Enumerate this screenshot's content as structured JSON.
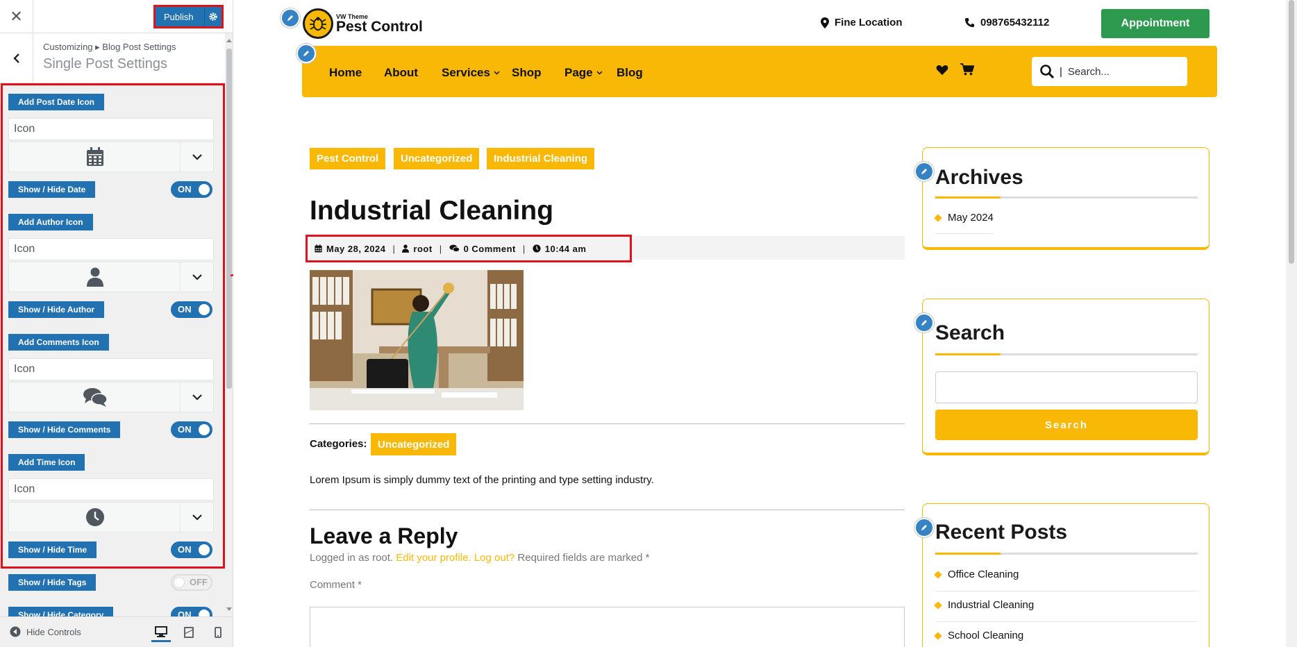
{
  "customizer": {
    "publish_label": "Publish",
    "breadcrumb": "Customizing ▸ Blog Post Settings",
    "section_title": "Single Post Settings",
    "controls": [
      {
        "button": "Add Post Date Icon",
        "field": "Icon",
        "icon": "calendar-icon",
        "toggle_label": "Show / Hide Date",
        "toggle": "ON"
      },
      {
        "button": "Add Author Icon",
        "field": "Icon",
        "icon": "user-icon",
        "toggle_label": "Show / Hide Author",
        "toggle": "ON"
      },
      {
        "button": "Add Comments Icon",
        "field": "Icon",
        "icon": "comments-icon",
        "toggle_label": "Show / Hide Comments",
        "toggle": "ON"
      },
      {
        "button": "Add Time Icon",
        "field": "Icon",
        "icon": "clock-icon",
        "toggle_label": "Show / Hide Time",
        "toggle": "ON"
      }
    ],
    "tags_toggle_label": "Show / Hide Tags",
    "tags_toggle": "OFF",
    "category_toggle_label": "Show / Hide Category",
    "category_toggle": "ON",
    "hide_controls": "Hide Controls"
  },
  "site": {
    "logo_sub": "VW Theme",
    "logo_name": "Pest Control",
    "location": "Fine Location",
    "phone": "098765432112",
    "appointment": "Appointment",
    "nav": [
      "Home",
      "About",
      "Services",
      "Shop",
      "Page",
      "Blog"
    ],
    "search_placeholder": "Search..."
  },
  "post": {
    "tags": [
      "Pest Control",
      "Uncategorized",
      "Industrial Cleaning"
    ],
    "title": "Industrial Cleaning",
    "date": "May 28, 2024",
    "author": "root",
    "comments": "0 Comment",
    "time": "10:44 am",
    "categories_label": "Categories:",
    "category": "Uncategorized",
    "excerpt": "Lorem Ipsum is simply dummy text of the printing and type setting industry.",
    "reply_title": "Leave a Reply",
    "logged_in": "Logged in as root.",
    "edit_profile": "Edit your profile.",
    "log_out": "Log out?",
    "required": "Required fields are marked *",
    "comment_label": "Comment *"
  },
  "sidebar": {
    "archives_title": "Archives",
    "archives": [
      "May 2024"
    ],
    "search_title": "Search",
    "search_button": "Search",
    "recent_title": "Recent Posts",
    "recent": [
      "Office Cleaning",
      "Industrial Cleaning",
      "School Cleaning"
    ]
  },
  "colors": {
    "brand_yellow": "#f9b806",
    "wp_blue": "#2271b1",
    "appointment_green": "#2e9a4f",
    "highlight_red": "#e0101c"
  }
}
